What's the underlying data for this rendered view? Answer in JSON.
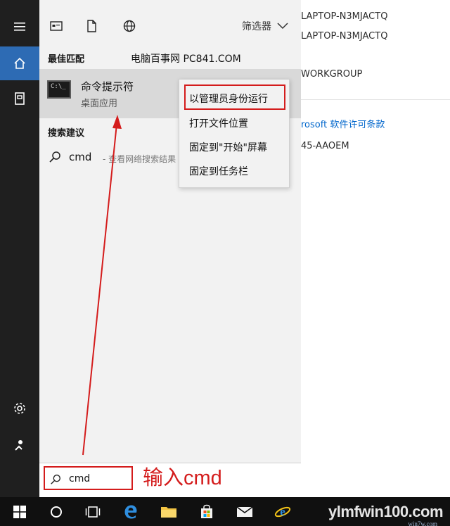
{
  "background_window": {
    "computer_name": "LAPTOP-N3MJACTQ",
    "full_computer_name": "LAPTOP-N3MJACTQ",
    "workgroup": "WORKGROUP",
    "license_link": "rosoft 软件许可条款",
    "product_id": "45-AAOEM"
  },
  "filter": {
    "label": "筛选器"
  },
  "sections": {
    "best_match": "最佳匹配",
    "suggestions": "搜索建议"
  },
  "watermark_top": "电脑百事网 PC841.COM",
  "best_match_item": {
    "title": "命令提示符",
    "subtitle": "桌面应用",
    "icon_text": "C:\\_"
  },
  "suggestion": {
    "term": "cmd",
    "description": " - 查看网络搜索结果"
  },
  "context_menu": {
    "items": [
      "以管理员身份运行",
      "打开文件位置",
      "固定到\"开始\"屏幕",
      "固定到任务栏"
    ]
  },
  "search": {
    "value": "cmd"
  },
  "annotation": {
    "label": "输入cmd"
  },
  "brand": {
    "main": "ylmfwin100.com",
    "sub": "win7w.com"
  },
  "colors": {
    "accent": "#2d6bb4",
    "annotation_red": "#d41c1c",
    "link_blue": "#0066cc"
  }
}
